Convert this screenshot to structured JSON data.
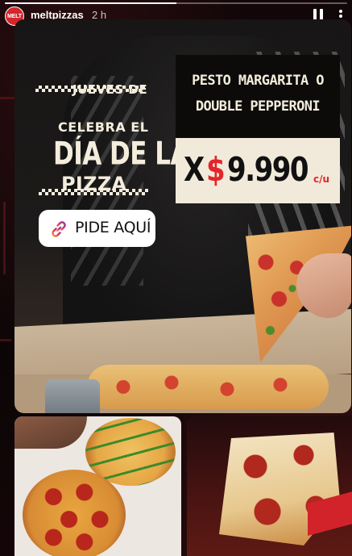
{
  "story": {
    "progress": 0.5,
    "account": {
      "avatar_text": "MELT",
      "username": "meltpizzas",
      "time_ago": "2 h"
    }
  },
  "promo": {
    "eyebrow": "JUEVES DE",
    "headline_1": "CELEBRA EL",
    "headline_2": "DÍA DE LA",
    "headline_3": "PIZZA",
    "cta_label": "PIDE AQUÍ",
    "cta_icon": "link-icon",
    "products_line_1": "PESTO MARGARITA O",
    "products_line_2": "DOUBLE PEPPERONI",
    "price_prefix": "X",
    "price_symbol": "$",
    "price_value": "9.990",
    "price_unit": "c/u"
  },
  "colors": {
    "brand_red": "#e3262b",
    "cream": "#f4eddc"
  }
}
